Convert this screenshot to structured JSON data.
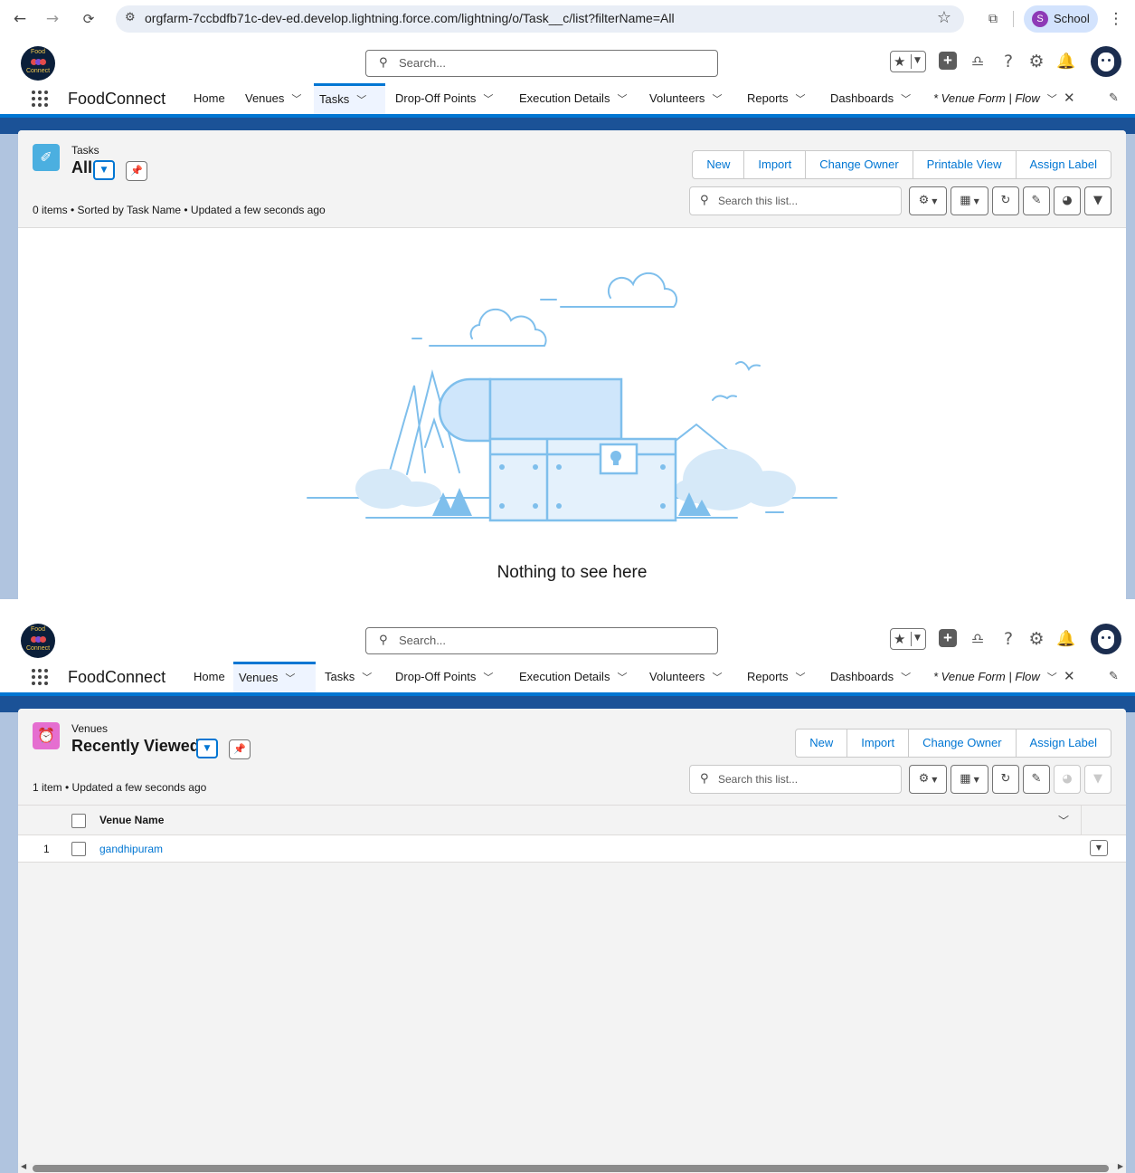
{
  "browser": {
    "url": "orgfarm-7ccbdfb71c-dev-ed.develop.lightning.force.com/lightning/o/Task__c/list?filterName=All",
    "back_icon": "←",
    "forward_icon": "→",
    "reload_icon": "C",
    "profile_initial": "S",
    "profile_name": "School",
    "menu_icon": "⋮"
  },
  "logo": {
    "line1": "Food",
    "line2": "Connect"
  },
  "header": {
    "search_placeholder": "Search...",
    "search_icon": "magnifier-icon"
  },
  "nav": {
    "app_name": "FoodConnect",
    "items": [
      {
        "label": "Home"
      },
      {
        "label": "Venues"
      },
      {
        "label": "Tasks"
      },
      {
        "label": "Drop-Off Points"
      },
      {
        "label": "Execution Details"
      },
      {
        "label": "Volunteers"
      },
      {
        "label": "Reports"
      },
      {
        "label": "Dashboards"
      },
      {
        "label": "* Venue Form | Flow"
      }
    ]
  },
  "tasks_list": {
    "object_label": "Tasks",
    "view_name": "All",
    "meta": "0 items • Sorted by Task Name • Updated a few seconds ago",
    "buttons": [
      "New",
      "Import",
      "Change Owner",
      "Printable View",
      "Assign Label"
    ],
    "search_placeholder": "Search this list...",
    "empty_message": "Nothing to see here",
    "icon_color": "#4bafe0"
  },
  "venues_list": {
    "object_label": "Venues",
    "view_name": "Recently Viewed",
    "meta": "1 item • Updated a few seconds ago",
    "buttons": [
      "New",
      "Import",
      "Change Owner",
      "Assign Label"
    ],
    "search_placeholder": "Search this list...",
    "column_header": "Venue Name",
    "rows": [
      {
        "num": "1",
        "name": "gandhipuram"
      }
    ],
    "icon_color": "#e56ed0"
  },
  "colors": {
    "brand": "#0176d3",
    "page_band": "#1b5297"
  }
}
